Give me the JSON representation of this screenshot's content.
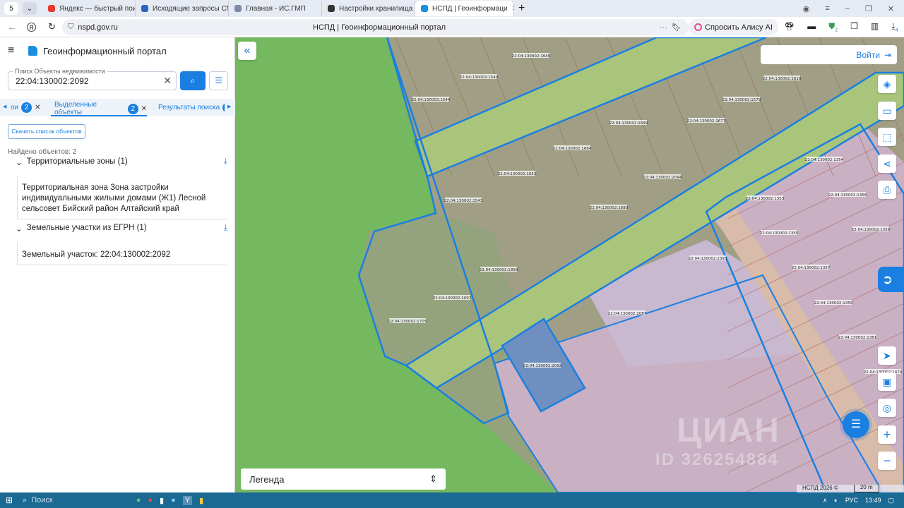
{
  "browser": {
    "tab_count": "5",
    "tabs": [
      {
        "label": "Яндекс — быстрый поиск",
        "color": "#e5392d"
      },
      {
        "label": "Исходящие запросы СМЭВ",
        "color": "#2c64c4"
      },
      {
        "label": "Главная - ИС.ГМП",
        "color": "#7c8aa6"
      },
      {
        "label": "Настройки хранилища л",
        "color": "#333333"
      },
      {
        "label": "НСПД | Геоинформаци",
        "color": "#1a8fe0"
      }
    ],
    "url": "nspd.gov.ru",
    "page_title": "НСПД | Геоинформационный портал",
    "alice": "Спросить Алису AI",
    "ext_badge_1": "2",
    "ext_badge_2": "4"
  },
  "panel": {
    "title": "Геоинформационный портал",
    "search_label": "Поиск Объекты недвижимости",
    "search_value": "22:04:130002:2092",
    "tabs": [
      {
        "label": "ои",
        "count": "2"
      },
      {
        "label": "Выделенные объекты",
        "count": "2"
      },
      {
        "label": "Результаты поиска",
        "count": "1"
      }
    ],
    "download_list": "Скачать список объектов",
    "found": "Найдено объектов: 2",
    "groups": [
      {
        "title": "Территориальные зоны (1)",
        "item": "Территориальная зона Зона застройки индивидуальными жилыми домами (Ж1) Лесной сельсовет Бийский район Алтайский край"
      },
      {
        "title": "Земельные участки из ЕГРН (1)",
        "item": "Земельный участок: 22:04:130002:2092"
      }
    ]
  },
  "map": {
    "login": "Войти",
    "legend": "Легенда",
    "copyright": "НСПД 2026 ©",
    "scale": "20 m",
    "watermark_1": "ЦИАН",
    "watermark_2": "ID 326254884",
    "selected_parcel": "22:04:130002:2092",
    "colors": {
      "accent": "#1a7fe0",
      "forest": "#74b85f",
      "zone": "#a09f86",
      "residential": "#c9b0c3",
      "road": "#a9c47b",
      "selected": "#6f8fc0"
    },
    "parcels": [
      "22:04:130002:1649",
      "22:04:130002:1549",
      "22:04:130002:1544",
      "22:04:130002:1618",
      "22:04:130002:1579",
      "22:04:130002:1677",
      "22:04:130002:1699",
      "22:04:130002:1684",
      "22:04:130002:1651",
      "22:04:130002:2094",
      "22:04:130002:1543",
      "22:04:130002:1680",
      "22:04:130002:1354",
      "22:04:130002:1353",
      "22:04:130002:1356",
      "22:04:130002:1355",
      "22:04:130002:1358",
      "22:04:130002:2393",
      "22:04:130002:1893",
      "22:04:130002:2097",
      "22:04:130002:1705",
      "22:04:130002:2087",
      "22:04:130002:2092",
      "22:04:130002:1357",
      "22:04:130002:1359",
      "22:04:130002:1361",
      "22:04:130002:1474"
    ]
  },
  "taskbar": {
    "search": "Поиск",
    "lang": "РУС",
    "time": "13:49"
  }
}
